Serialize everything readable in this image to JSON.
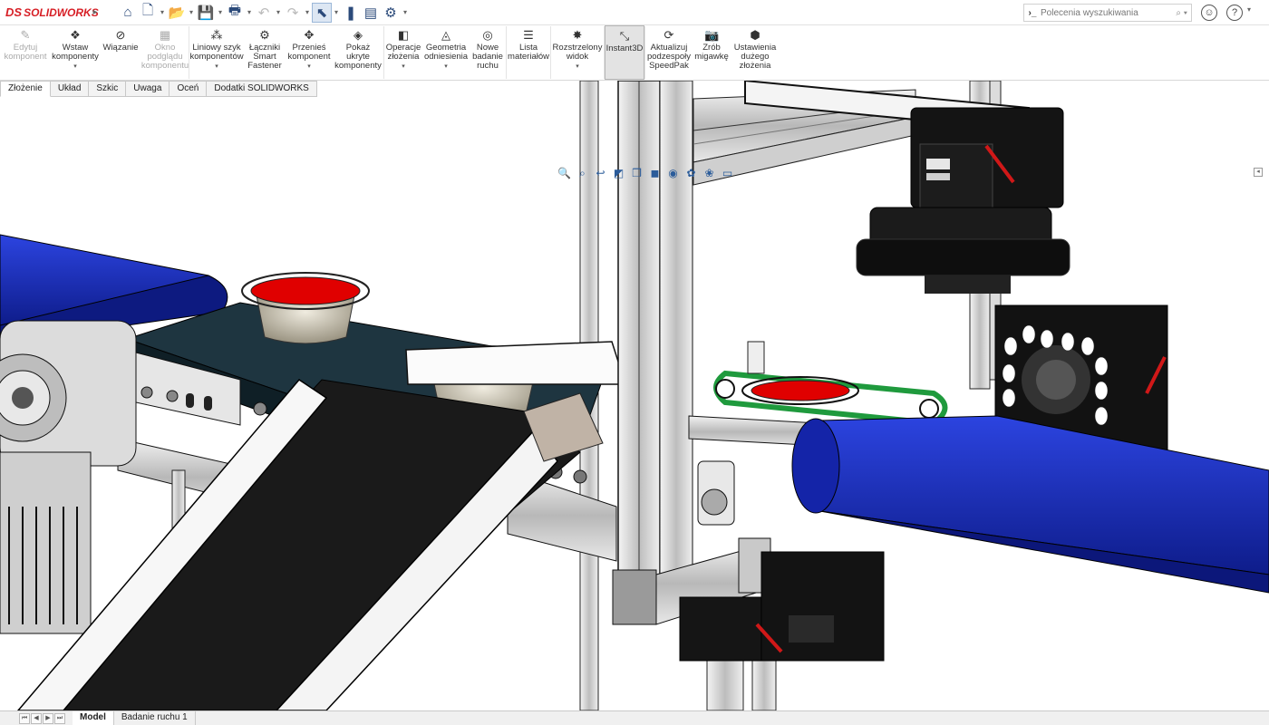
{
  "app": {
    "name": "SOLIDWORKS",
    "logo_prefix": "DS",
    "accent": "#d71f26"
  },
  "quick_access": [
    {
      "name": "home-icon",
      "glyph": "⌂"
    },
    {
      "name": "new-document-icon",
      "glyph": "🗋"
    },
    {
      "name": "open-icon",
      "glyph": "📂"
    },
    {
      "name": "save-icon",
      "glyph": "💾"
    },
    {
      "name": "print-icon",
      "glyph": "🖶"
    },
    {
      "name": "undo-icon",
      "glyph": "↶"
    },
    {
      "name": "redo-icon",
      "glyph": "↷"
    },
    {
      "name": "select-icon",
      "glyph": "⬉"
    },
    {
      "name": "rebuild-icon",
      "glyph": "❚"
    },
    {
      "name": "file-properties-icon",
      "glyph": "▤"
    },
    {
      "name": "options-icon",
      "glyph": "⚙"
    }
  ],
  "search": {
    "placeholder": "Polecenia wyszukiwania"
  },
  "ribbon": [
    {
      "label": "Edytuj komponent",
      "icon": "edit-component-icon",
      "glyph": "✎",
      "disabled": true,
      "dropdown": false
    },
    {
      "label": "Wstaw komponenty",
      "icon": "insert-components-icon",
      "glyph": "❖",
      "disabled": false,
      "dropdown": true
    },
    {
      "label": "Wiązanie",
      "icon": "mate-icon",
      "glyph": "⊘",
      "disabled": false,
      "dropdown": false
    },
    {
      "label": "Okno podglądu komponentu",
      "icon": "preview-window-icon",
      "glyph": "▦",
      "disabled": true,
      "dropdown": false
    },
    {
      "label": "Liniowy szyk komponentów",
      "icon": "linear-pattern-icon",
      "glyph": "⁂",
      "disabled": false,
      "dropdown": true
    },
    {
      "label": "Łączniki Smart Fastener",
      "icon": "smart-fasteners-icon",
      "glyph": "⚙",
      "disabled": false,
      "dropdown": false
    },
    {
      "label": "Przenieś komponent",
      "icon": "move-component-icon",
      "glyph": "✥",
      "disabled": false,
      "dropdown": true
    },
    {
      "label": "Pokaż ukryte komponenty",
      "icon": "show-hidden-icon",
      "glyph": "◈",
      "disabled": false,
      "dropdown": false
    },
    {
      "label": "Operacje złożenia",
      "icon": "assembly-features-icon",
      "glyph": "◧",
      "disabled": false,
      "dropdown": true
    },
    {
      "label": "Geometria odniesienia",
      "icon": "reference-geometry-icon",
      "glyph": "◬",
      "disabled": false,
      "dropdown": true
    },
    {
      "label": "Nowe badanie ruchu",
      "icon": "motion-study-icon",
      "glyph": "◎",
      "disabled": false,
      "dropdown": false
    },
    {
      "label": "Lista materiałów",
      "icon": "bom-icon",
      "glyph": "☰",
      "disabled": false,
      "dropdown": false
    },
    {
      "label": "Rozstrzelony widok",
      "icon": "exploded-view-icon",
      "glyph": "✸",
      "disabled": false,
      "dropdown": true
    },
    {
      "label": "Instant3D",
      "icon": "instant3d-icon",
      "glyph": "⤡",
      "disabled": false,
      "dropdown": false,
      "active": true
    },
    {
      "label": "Aktualizuj podzespoły SpeedPak",
      "icon": "speedpak-icon",
      "glyph": "⟳",
      "disabled": false,
      "dropdown": false
    },
    {
      "label": "Zrób migawkę",
      "icon": "snapshot-icon",
      "glyph": "📷",
      "disabled": false,
      "dropdown": false
    },
    {
      "label": "Ustawienia dużego złożenia",
      "icon": "large-assembly-icon",
      "glyph": "⬢",
      "disabled": false,
      "dropdown": false
    }
  ],
  "tabs": [
    "Złożenie",
    "Układ",
    "Szkic",
    "Uwaga",
    "Oceń",
    "Dodatki SOLIDWORKS"
  ],
  "active_tab": 0,
  "hud": [
    {
      "name": "zoom-to-fit-icon",
      "glyph": "🔍"
    },
    {
      "name": "zoom-area-icon",
      "glyph": "⌕"
    },
    {
      "name": "previous-view-icon",
      "glyph": "↩"
    },
    {
      "name": "section-view-icon",
      "glyph": "◩"
    },
    {
      "name": "view-orientation-icon",
      "glyph": "❒"
    },
    {
      "name": "display-style-icon",
      "glyph": "◼"
    },
    {
      "name": "hide-show-icon",
      "glyph": "◉"
    },
    {
      "name": "appearance-icon",
      "glyph": "✿"
    },
    {
      "name": "scene-icon",
      "glyph": "❀"
    },
    {
      "name": "view-settings-icon",
      "glyph": "▭"
    }
  ],
  "bottom_tabs": [
    "Model",
    "Badanie ruchu 1"
  ],
  "active_bottom_tab": 0,
  "colors": {
    "conveyor_blue": "#1a2fb4",
    "cup_lid_red": "#e00000",
    "belt_dark": "#1e3540",
    "frame_gray": "#d9d9d9"
  }
}
